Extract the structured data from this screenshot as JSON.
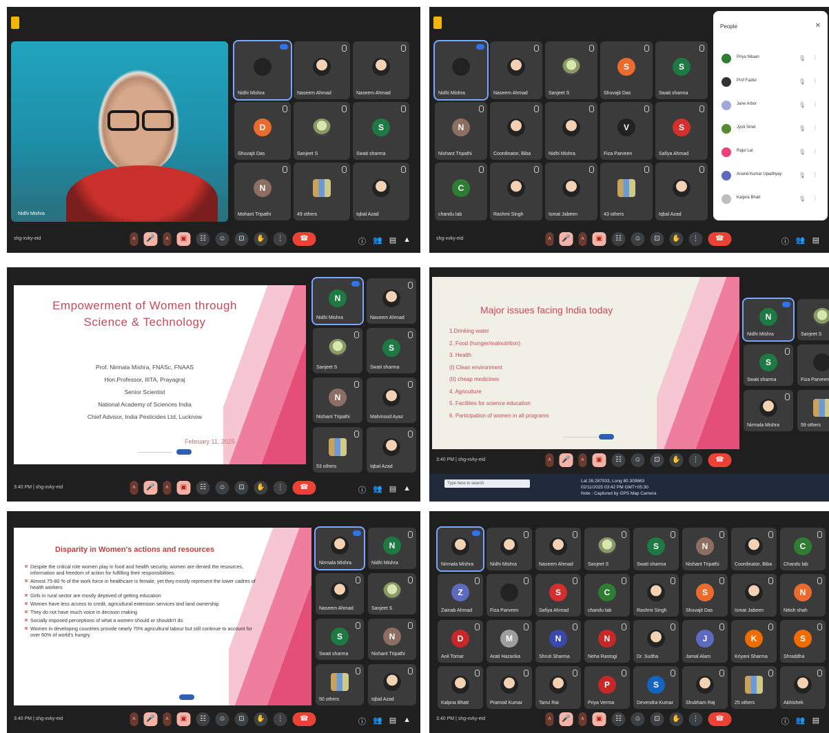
{
  "common": {
    "meeting_code": "shg-xvky-eid",
    "time": "3:40 PM",
    "control_icons": [
      "mic-icon",
      "camera-icon",
      "captions-icon",
      "emoji-icon",
      "present-icon",
      "raise-hand-icon",
      "more-icon",
      "end-call-icon"
    ]
  },
  "p1": {
    "speaker_name": "Nidhi Mishra",
    "tiles": [
      {
        "name": "Nidhi Mishra",
        "kind": "dark"
      },
      {
        "name": "Naseem Ahmad",
        "kind": "photo"
      },
      {
        "name": "Naseem Ahmad",
        "kind": "photo"
      },
      {
        "name": "Shuvajit Das",
        "kind": "letter",
        "letter": "D",
        "color": "#e96b2d"
      },
      {
        "name": "Sanjeet S",
        "kind": "flower"
      },
      {
        "name": "Swati sharma",
        "kind": "letter",
        "letter": "S",
        "color": "#1e7a43"
      },
      {
        "name": "Mohant Tripathi",
        "kind": "letter",
        "letter": "N",
        "color": "#8d6e63"
      },
      {
        "name": "49 others",
        "kind": "group"
      },
      {
        "name": "Iqbal Azad",
        "kind": "photo"
      }
    ]
  },
  "p2": {
    "people_header": "People",
    "people": [
      {
        "name": "Priya Nitaan",
        "color": "#2e7d32"
      },
      {
        "name": "Prof Fazlul",
        "color": "#333333"
      },
      {
        "name": "Jane Arbor",
        "color": "#9fa8da"
      },
      {
        "name": "Jyoti Sinet",
        "color": "#558b2f"
      },
      {
        "name": "Rajul Lal",
        "color": "#ec407a"
      },
      {
        "name": "Anand Kumar Upadhyay",
        "color": "#5c6bc0"
      },
      {
        "name": "Kalpna Bhatt",
        "color": "#bdbdbd"
      }
    ],
    "tiles": [
      {
        "name": "Nidhi Mishra",
        "kind": "dark"
      },
      {
        "name": "Naseem Ahmad",
        "kind": "photo"
      },
      {
        "name": "Sanjeet S",
        "kind": "flower"
      },
      {
        "name": "Shuvajit Das",
        "kind": "letter",
        "letter": "S",
        "color": "#e96b2d"
      },
      {
        "name": "Swati sharma",
        "kind": "letter",
        "letter": "S",
        "color": "#1e7a43"
      },
      {
        "name": "Nishant Tripathi",
        "kind": "letter",
        "letter": "N",
        "color": "#8d6e63"
      },
      {
        "name": "Coordinator, Biba",
        "kind": "photo"
      },
      {
        "name": "Nidhi Mishra",
        "kind": "photo"
      },
      {
        "name": "Fiza Parveen",
        "kind": "letter",
        "letter": "V",
        "color": "#222222"
      },
      {
        "name": "Safiya Ahmad",
        "kind": "letter",
        "letter": "S",
        "color": "#d32f2f"
      },
      {
        "name": "chandu lab",
        "kind": "letter",
        "letter": "C",
        "color": "#2e7d32"
      },
      {
        "name": "Rashmi Singh",
        "kind": "photo"
      },
      {
        "name": "Ismat Jabeen",
        "kind": "photo"
      },
      {
        "name": "43 others",
        "kind": "group"
      },
      {
        "name": "Iqbal Azad",
        "kind": "photo"
      }
    ]
  },
  "p3": {
    "slide_title_1": "Empowerment of Women through",
    "slide_title_2": "Science & Technology",
    "info": [
      "Prof. Nirmala Mishra, FNASc, FNAAS",
      "Hon.Professor, IIITA, Prayagraj",
      "Senior Scientist",
      "National Academy of Sciences India",
      "Chief Advisor, India Pesticides Ltd, Lucknow"
    ],
    "date": "February 11, 2025",
    "tiles": [
      {
        "name": "Nidhi Mishra",
        "kind": "letter",
        "letter": "N",
        "color": "#1e7a43"
      },
      {
        "name": "Naseem Ahmad",
        "kind": "photo"
      },
      {
        "name": "Sanjeet S",
        "kind": "flower"
      },
      {
        "name": "Swati sharma",
        "kind": "letter",
        "letter": "S",
        "color": "#1e7a43"
      },
      {
        "name": "Nishant Tripathi",
        "kind": "letter",
        "letter": "N",
        "color": "#8d6e63"
      },
      {
        "name": "Mahmood Ayaz",
        "kind": "photo"
      },
      {
        "name": "53 others",
        "kind": "group"
      },
      {
        "name": "Iqbal Azad",
        "kind": "photo"
      }
    ]
  },
  "p4": {
    "slide_title": "Major issues facing India today",
    "items": [
      "1.Drinking water",
      "2. Food (hunger/malnutrition)",
      "3. Health",
      "(I) Clean environment",
      "(II) cheap medicines",
      "4. Agriculture",
      "5. Facilities for science education",
      "6. Participation of women in all programs"
    ],
    "tiles": [
      {
        "name": "Nidhi Mishra",
        "kind": "letter",
        "letter": "N",
        "color": "#1e7a43"
      },
      {
        "name": "Sanjeet S",
        "kind": "flower"
      },
      {
        "name": "Swati sharma",
        "kind": "letter",
        "letter": "S",
        "color": "#1e7a43"
      },
      {
        "name": "Fiza Parveen",
        "kind": "dark"
      },
      {
        "name": "Nirmala Mishra",
        "kind": "photo"
      },
      {
        "name": "59 others",
        "kind": "group"
      }
    ],
    "taskbar_search": "Type here to search",
    "gps_1": "Lat 26.287933, Long 80.309863",
    "gps_2": "02/11/2025 03:42 PM GMT+05:30",
    "gps_3": "Note : Captured by GPS Map Camera"
  },
  "p5": {
    "slide_title": "Disparity in Women's actions and resources",
    "items": [
      "Despite the critical role women play in food and health security, women are denied the resources, information and freedom of action for fulfilling their responsibilities.",
      "Almost 75-80 % of the work force in healthcare is female, yet they mostly represent the lower cadres of health workers",
      "Girls in rural sector are mostly deprived of getting education",
      "Women have less access to credit, agricultural extension services and land ownership",
      "They do not have much voice in decision making",
      "Socially imposed perceptions of what a women should or shouldn't do",
      "Women in developing countries provide nearly 70% agricultural labour but still continue to account for over 60% of world's hungry."
    ],
    "tiles": [
      {
        "name": "Nirmala Mishra",
        "kind": "photo"
      },
      {
        "name": "Nidhi Mishra",
        "kind": "letter",
        "letter": "N",
        "color": "#1e7a43"
      },
      {
        "name": "Naseem Ahmad",
        "kind": "photo"
      },
      {
        "name": "Sanjeet S",
        "kind": "flower"
      },
      {
        "name": "Swati sharma",
        "kind": "letter",
        "letter": "S",
        "color": "#1e7a43"
      },
      {
        "name": "Nishant Tripathi",
        "kind": "letter",
        "letter": "N",
        "color": "#8d6e63"
      },
      {
        "name": "50 others",
        "kind": "group"
      },
      {
        "name": "Iqbal Azad",
        "kind": "photo"
      }
    ]
  },
  "p6": {
    "tiles": [
      {
        "name": "Nirmala Mishra",
        "kind": "photo"
      },
      {
        "name": "Nidhi Mishra",
        "kind": "photo"
      },
      {
        "name": "Naseem Ahmad",
        "kind": "photo"
      },
      {
        "name": "Sanjeet S",
        "kind": "flower"
      },
      {
        "name": "Swati sharma",
        "kind": "letter",
        "letter": "S",
        "color": "#1e7a43"
      },
      {
        "name": "Nishant Tripathi",
        "kind": "letter",
        "letter": "N",
        "color": "#8d6e63"
      },
      {
        "name": "Coordinator, Biba",
        "kind": "photo"
      },
      {
        "name": "Chandu lab",
        "kind": "letter",
        "letter": "C",
        "color": "#2e7d32"
      },
      {
        "name": "Zainab Ahmad",
        "kind": "letter",
        "letter": "Z",
        "color": "#5c6bc0"
      },
      {
        "name": "Fiza Parveen",
        "kind": "dark"
      },
      {
        "name": "Safiya Ahmad",
        "kind": "letter",
        "letter": "S",
        "color": "#d32f2f"
      },
      {
        "name": "chandu lab",
        "kind": "letter",
        "letter": "C",
        "color": "#2e7d32"
      },
      {
        "name": "Rashmi Singh",
        "kind": "photo"
      },
      {
        "name": "Shuvajit Das",
        "kind": "letter",
        "letter": "S",
        "color": "#e96b2d"
      },
      {
        "name": "Ismat Jabeen",
        "kind": "photo"
      },
      {
        "name": "Nitish shah",
        "kind": "letter",
        "letter": "N",
        "color": "#e96b2d"
      },
      {
        "name": "Anil Tomar",
        "kind": "letter",
        "letter": "D",
        "color": "#c62828"
      },
      {
        "name": "Arati Hazarika",
        "kind": "letter",
        "letter": "M",
        "color": "#9e9e9e"
      },
      {
        "name": "Shruti Sharma",
        "kind": "letter",
        "letter": "N",
        "color": "#3949ab"
      },
      {
        "name": "Neha Rastogi",
        "kind": "letter",
        "letter": "N",
        "color": "#c62828"
      },
      {
        "name": "Dr. Sudha",
        "kind": "photo"
      },
      {
        "name": "Jamal Alam",
        "kind": "letter",
        "letter": "J",
        "color": "#5c6bc0"
      },
      {
        "name": "Kriyani Sharma",
        "kind": "letter",
        "letter": "K",
        "color": "#ef6c00"
      },
      {
        "name": "Shraddha",
        "kind": "letter",
        "letter": "S",
        "color": "#ef6c00"
      },
      {
        "name": "Kalpna Bhatt",
        "kind": "photo"
      },
      {
        "name": "Pramod Kumar",
        "kind": "photo"
      },
      {
        "name": "Tanvi Rai",
        "kind": "photo"
      },
      {
        "name": "Priya Verma",
        "kind": "letter",
        "letter": "P",
        "color": "#c62828"
      },
      {
        "name": "Devendra Kumar",
        "kind": "letter",
        "letter": "S",
        "color": "#1565c0"
      },
      {
        "name": "Shubham Raj",
        "kind": "photo"
      },
      {
        "name": "25 others",
        "kind": "group"
      },
      {
        "name": "Abhishek",
        "kind": "photo"
      }
    ]
  }
}
